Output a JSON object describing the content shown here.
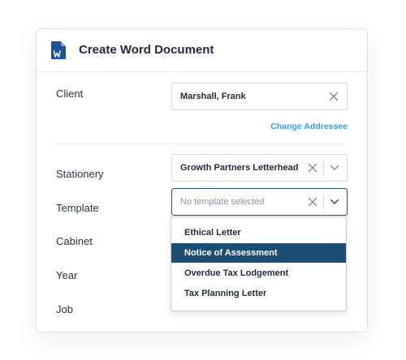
{
  "dialog": {
    "title": "Create Word Document",
    "icon": "word-document-icon"
  },
  "client": {
    "label": "Client",
    "value": "Marshall, Frank",
    "change_link": "Change Addressee"
  },
  "stationery": {
    "label": "Stationery",
    "value": "Growth Partners Letterhead"
  },
  "template": {
    "label": "Template",
    "placeholder": "No template selected",
    "options": [
      "Ethical Letter",
      "Notice of Assessment",
      "Overdue Tax Lodgement",
      "Tax Planning Letter"
    ],
    "highlighted_option": "Notice of Assessment"
  },
  "cabinet": {
    "label": "Cabinet"
  },
  "year": {
    "label": "Year"
  },
  "job": {
    "label": "Job"
  },
  "colors": {
    "word_blue": "#1f5398",
    "link": "#3b9ae0",
    "selected_bg": "#1c4e74",
    "text": "#1f2a3f"
  }
}
